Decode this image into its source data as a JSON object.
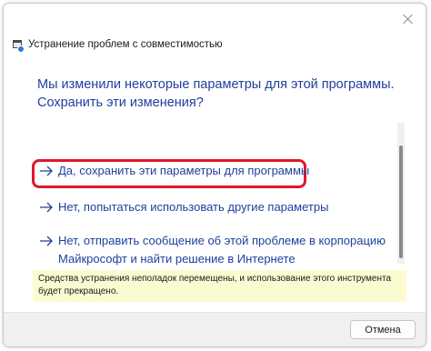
{
  "window": {
    "title": "Устранение проблем с совместимостью"
  },
  "main": {
    "heading": "Мы изменили некоторые параметры для этой программы. Сохранить эти изменения?",
    "options": [
      {
        "label": "Да, сохранить эти параметры для программы",
        "highlighted": true
      },
      {
        "label": "Нет, попытаться использовать другие параметры",
        "highlighted": false
      },
      {
        "label": "Нет, отправить сообщение об этой проблеме в корпорацию Майкрософт и найти решение в Интернете",
        "highlighted": false
      }
    ],
    "notice": "Средства устранения неполадок перемещены, и использование этого инструмента будет прекращено."
  },
  "footer": {
    "cancel_label": "Отмена"
  },
  "colors": {
    "link": "#1f3f9d",
    "highlight_border": "#e2172a",
    "notice_bg": "#fbfbd2"
  },
  "icons": [
    "close-icon",
    "app-icon",
    "arrow-right-icon"
  ]
}
